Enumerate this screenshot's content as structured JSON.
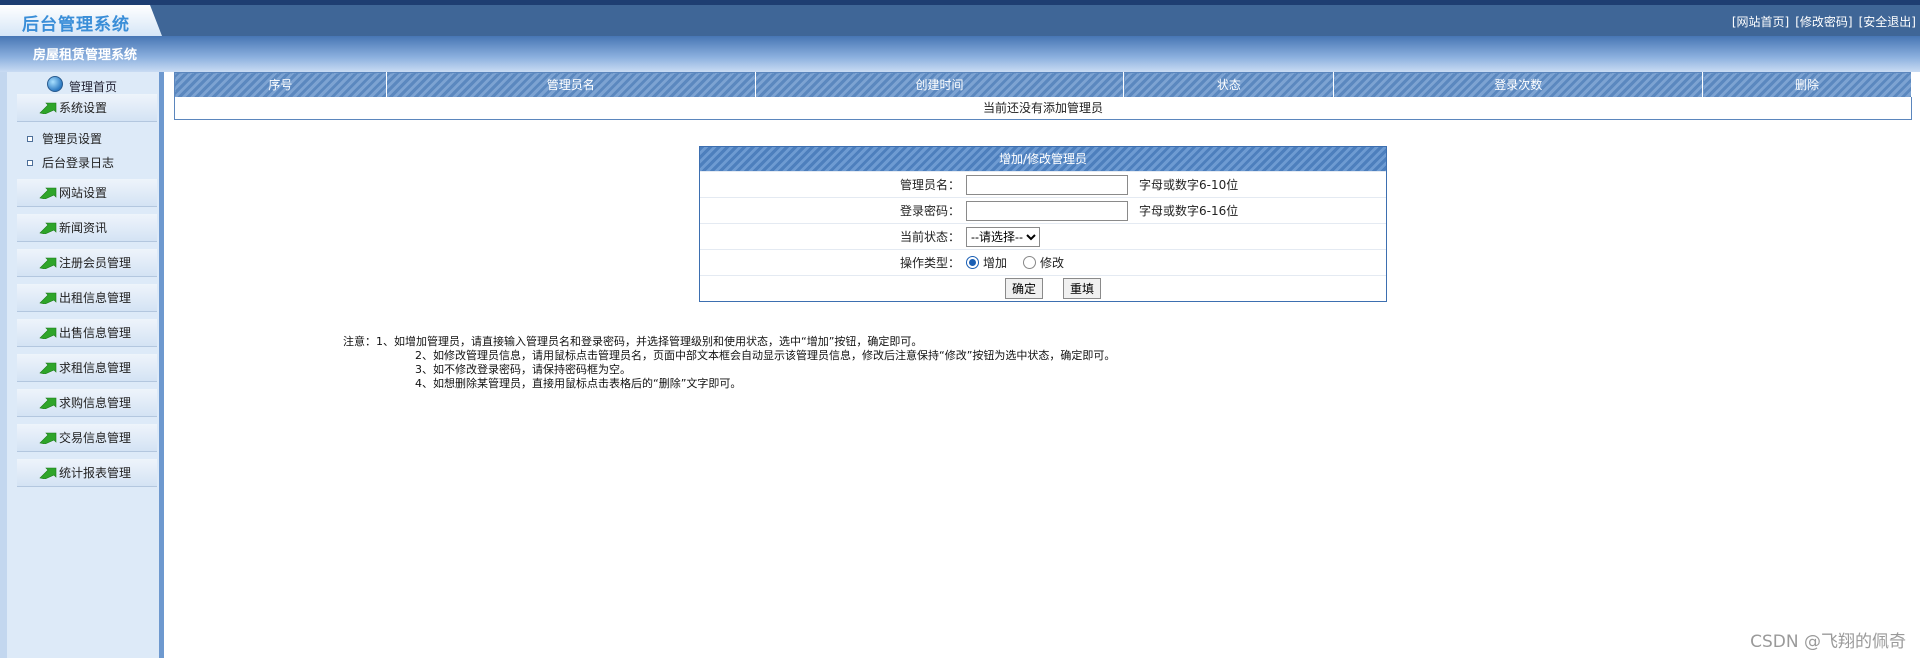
{
  "header": {
    "logo_text": "后台管理系统",
    "links": [
      "[网站首页]",
      "[修改密码]",
      "[安全退出]"
    ],
    "sub_title": "房屋租赁管理系统"
  },
  "sidebar": {
    "home_label": "管理首页",
    "menus": [
      {
        "label": "系统设置",
        "icon": "green-arrow-icon"
      },
      {
        "label": "网站设置",
        "icon": "green-arrow-icon"
      },
      {
        "label": "新闻资讯",
        "icon": "green-arrow-icon"
      },
      {
        "label": "注册会员管理",
        "icon": "green-arrow-icon"
      },
      {
        "label": "出租信息管理",
        "icon": "green-arrow-icon"
      },
      {
        "label": "出售信息管理",
        "icon": "green-arrow-icon"
      },
      {
        "label": "求租信息管理",
        "icon": "green-arrow-icon"
      },
      {
        "label": "求购信息管理",
        "icon": "green-arrow-icon"
      },
      {
        "label": "交易信息管理",
        "icon": "green-arrow-icon"
      },
      {
        "label": "统计报表管理",
        "icon": "green-arrow-icon"
      }
    ],
    "sub_items": [
      "管理员设置",
      "后台登录日志"
    ]
  },
  "admin_table": {
    "columns": [
      "序号",
      "管理员名",
      "创建时间",
      "状态",
      "登录次数",
      "删除"
    ],
    "empty_message": "当前还没有添加管理员"
  },
  "form": {
    "title": "增加/修改管理员",
    "username_label": "管理员名：",
    "username_value": "",
    "username_hint": "字母或数字6-10位",
    "password_label": "登录密码：",
    "password_value": "",
    "password_hint": "字母或数字6-16位",
    "status_label": "当前状态：",
    "status_selected": "--请选择--",
    "optype_label": "操作类型：",
    "optype_options": [
      "增加",
      "修改"
    ],
    "optype_selected": "增加",
    "confirm_button": "确定",
    "reset_button": "重填"
  },
  "notes": [
    "注意：1、如增加管理员，请直接输入管理员名和登录密码，并选择管理级别和使用状态，选中“增加”按钮，确定即可。",
    "2、如修改管理员信息，请用鼠标点击管理员名，页面中部文本框会自动显示该管理员信息，修改后注意保持“修改”按钮为选中状态，确定即可。",
    "3、如不修改登录密码，请保持密码框为空。",
    "4、如想删除某管理员，直接用鼠标点击表格后的“删除”文字即可。"
  ],
  "watermark": "CSDN @飞翔的佩奇",
  "colors": {
    "header_blue": "#3f6697",
    "sidebar_bg": "#ddeaf8",
    "table_header": "#5b88bf",
    "arrow_green": "#2fa52a"
  }
}
